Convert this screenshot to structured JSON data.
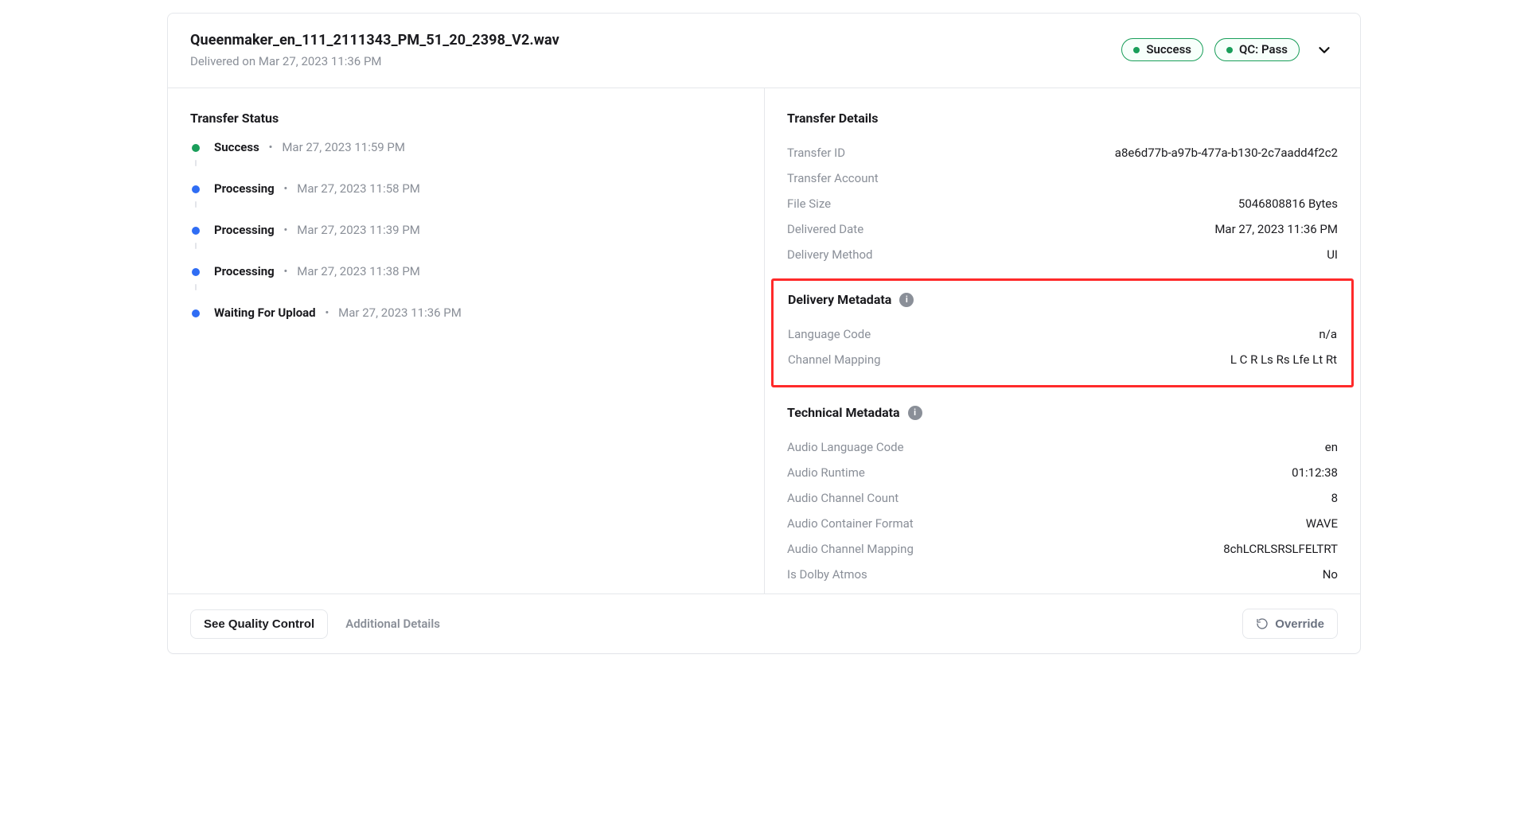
{
  "header": {
    "file_name": "Queenmaker_en_111_2111343_PM_51_20_2398_V2.wav",
    "delivered_on": "Delivered on Mar 27, 2023 11:36 PM",
    "badges": [
      {
        "label": "Success",
        "color": "green"
      },
      {
        "label": "QC: Pass",
        "color": "green"
      }
    ]
  },
  "left": {
    "title": "Transfer Status",
    "items": [
      {
        "label": "Success",
        "ts": "Mar 27, 2023 11:59 PM",
        "dot": "green"
      },
      {
        "label": "Processing",
        "ts": "Mar 27, 2023 11:58 PM",
        "dot": "blue"
      },
      {
        "label": "Processing",
        "ts": "Mar 27, 2023 11:39 PM",
        "dot": "blue"
      },
      {
        "label": "Processing",
        "ts": "Mar 27, 2023 11:38 PM",
        "dot": "blue"
      },
      {
        "label": "Waiting For Upload",
        "ts": "Mar 27, 2023 11:36 PM",
        "dot": "blue"
      }
    ]
  },
  "right": {
    "transfer_details": {
      "title": "Transfer Details",
      "rows": [
        {
          "k": "Transfer ID",
          "v": "a8e6d77b-a97b-477a-b130-2c7aadd4f2c2"
        },
        {
          "k": "Transfer Account",
          "v": ""
        },
        {
          "k": "File Size",
          "v": "5046808816 Bytes"
        },
        {
          "k": "Delivered Date",
          "v": "Mar 27, 2023 11:36 PM"
        },
        {
          "k": "Delivery Method",
          "v": "UI"
        }
      ]
    },
    "delivery_metadata": {
      "title": "Delivery Metadata",
      "rows": [
        {
          "k": "Language Code",
          "v": "n/a"
        },
        {
          "k": "Channel Mapping",
          "v": "L C R Ls Rs Lfe Lt Rt"
        }
      ]
    },
    "technical_metadata": {
      "title": "Technical Metadata",
      "rows": [
        {
          "k": "Audio Language Code",
          "v": "en"
        },
        {
          "k": "Audio Runtime",
          "v": "01:12:38"
        },
        {
          "k": "Audio Channel Count",
          "v": "8"
        },
        {
          "k": "Audio Container Format",
          "v": "WAVE"
        },
        {
          "k": "Audio Channel Mapping",
          "v": "8chLCRLSRSLFELTRT"
        },
        {
          "k": "Is Dolby Atmos",
          "v": "No"
        }
      ]
    }
  },
  "footer": {
    "see_qc": "See Quality Control",
    "additional_details": "Additional Details",
    "override": "Override"
  }
}
